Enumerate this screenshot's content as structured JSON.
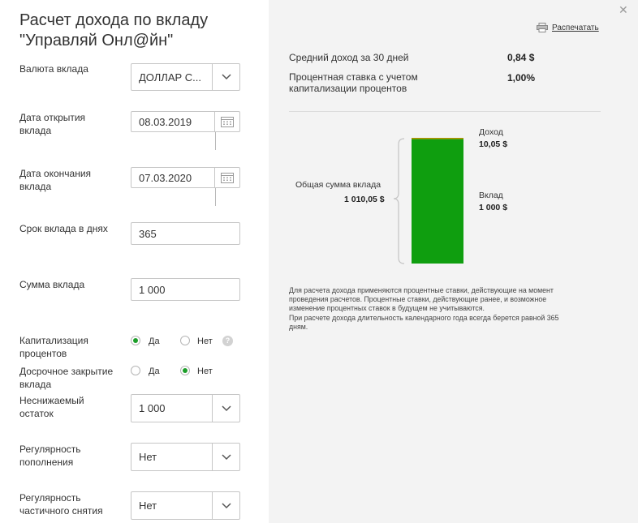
{
  "title": {
    "line1": "Расчет дохода по вкладу",
    "line2": "\"Управляй Онл@йн\""
  },
  "form": {
    "currency": {
      "label": "Валюта вклада",
      "value": "ДОЛЛАР С..."
    },
    "open_date": {
      "label_l1": "Дата открытия",
      "label_l2": "вклада",
      "value": "08.03.2019"
    },
    "close_date": {
      "label_l1": "Дата окончания",
      "label_l2": "вклада",
      "value": "07.03.2020"
    },
    "term": {
      "label": "Срок вклада в днях",
      "value": "365"
    },
    "amount": {
      "label": "Сумма вклада",
      "value": "1 000"
    },
    "capitalization": {
      "label_l1": "Капитализация",
      "label_l2": "процентов",
      "yes": "Да",
      "no": "Нет",
      "selected": "yes"
    },
    "early_close": {
      "label_l1": "Досрочное закрытие",
      "label_l2": "вклада",
      "yes": "Да",
      "no": "Нет",
      "selected": "no"
    },
    "min_balance": {
      "label_l1": "Неснижаемый",
      "label_l2": "остаток",
      "value": "1 000"
    },
    "replenishment": {
      "label_l1": "Регулярность",
      "label_l2": "пополнения",
      "value": "Нет"
    },
    "withdrawal": {
      "label_l1": "Регулярность",
      "label_l2": "частичного снятия",
      "value": "Нет"
    }
  },
  "result": {
    "print_label": "Распечатать",
    "avg_income_label": "Средний доход за 30 дней",
    "avg_income_value": "0,84 $",
    "rate_label_l1": "Процентная ставка с учетом",
    "rate_label_l2": "капитализации процентов",
    "rate_value": "1,00%",
    "total_label": "Общая сумма вклада",
    "total_value": "1 010,05 $",
    "income_label": "Доход",
    "income_value": "10,05 $",
    "deposit_label": "Вклад",
    "deposit_value": "1 000 $",
    "note_l1": "Для расчета дохода применяются процентные ставки, действующие на момент",
    "note_l2": "проведения расчетов. Процентные ставки, действующие ранее, и возможное",
    "note_l3": "изменение процентных ставок в будущем не учитываются.",
    "note_l4": "При расчете дохода длительность календарного года всегда берется равной 365",
    "note_l5": "дням."
  },
  "chart_data": {
    "type": "bar",
    "categories": [
      "Общая сумма вклада"
    ],
    "series": [
      {
        "name": "Вклад",
        "values": [
          1000
        ]
      },
      {
        "name": "Доход",
        "values": [
          10.05
        ]
      }
    ],
    "total": 1010.05
  },
  "colors": {
    "accent": "#1c9e29",
    "bar_deposit": "#0f9e0f",
    "bar_income": "#b29400"
  }
}
